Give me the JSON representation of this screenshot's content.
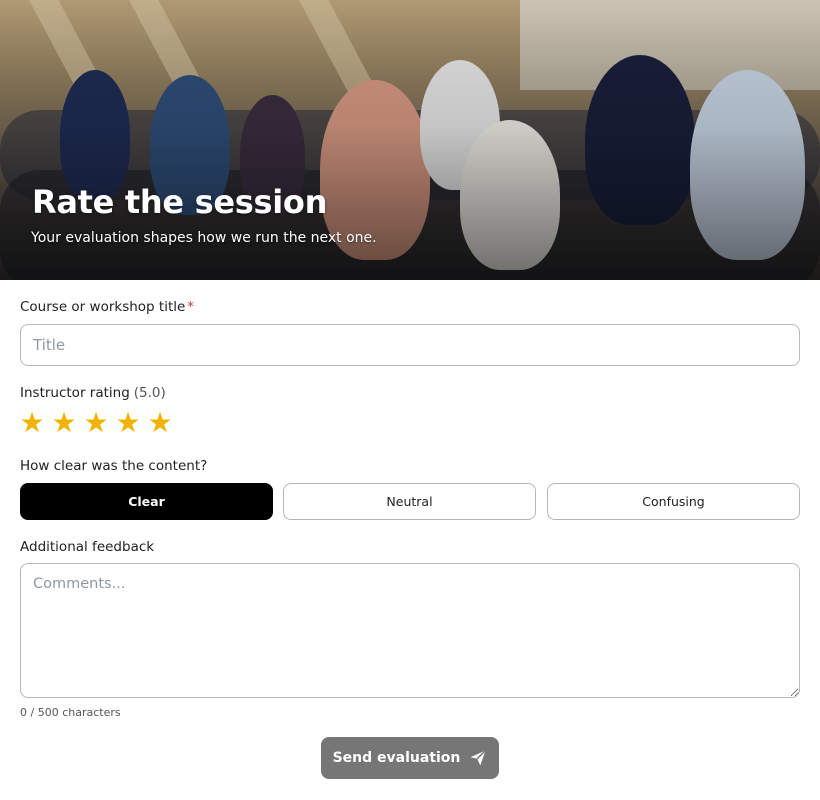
{
  "hero": {
    "title": "Rate the session",
    "subtitle": "Your evaluation shapes how we run the next one."
  },
  "course": {
    "label": "Course or workshop title",
    "required_marker": "*",
    "placeholder": "Title",
    "value": ""
  },
  "rating": {
    "label": "Instructor rating",
    "value_text": "(5.0)",
    "value": 5,
    "max": 5,
    "star_glyph": "★",
    "star_color": "#f0b400"
  },
  "clarity": {
    "label": "How clear was the content?",
    "options": [
      "Clear",
      "Neutral",
      "Confusing"
    ],
    "selected": "Clear"
  },
  "feedback": {
    "label": "Additional feedback",
    "placeholder": "Comments...",
    "counter": "0 / 500 characters"
  },
  "submit": {
    "label": "Send evaluation",
    "icon": "paper-plane-icon",
    "color": "#767676"
  }
}
